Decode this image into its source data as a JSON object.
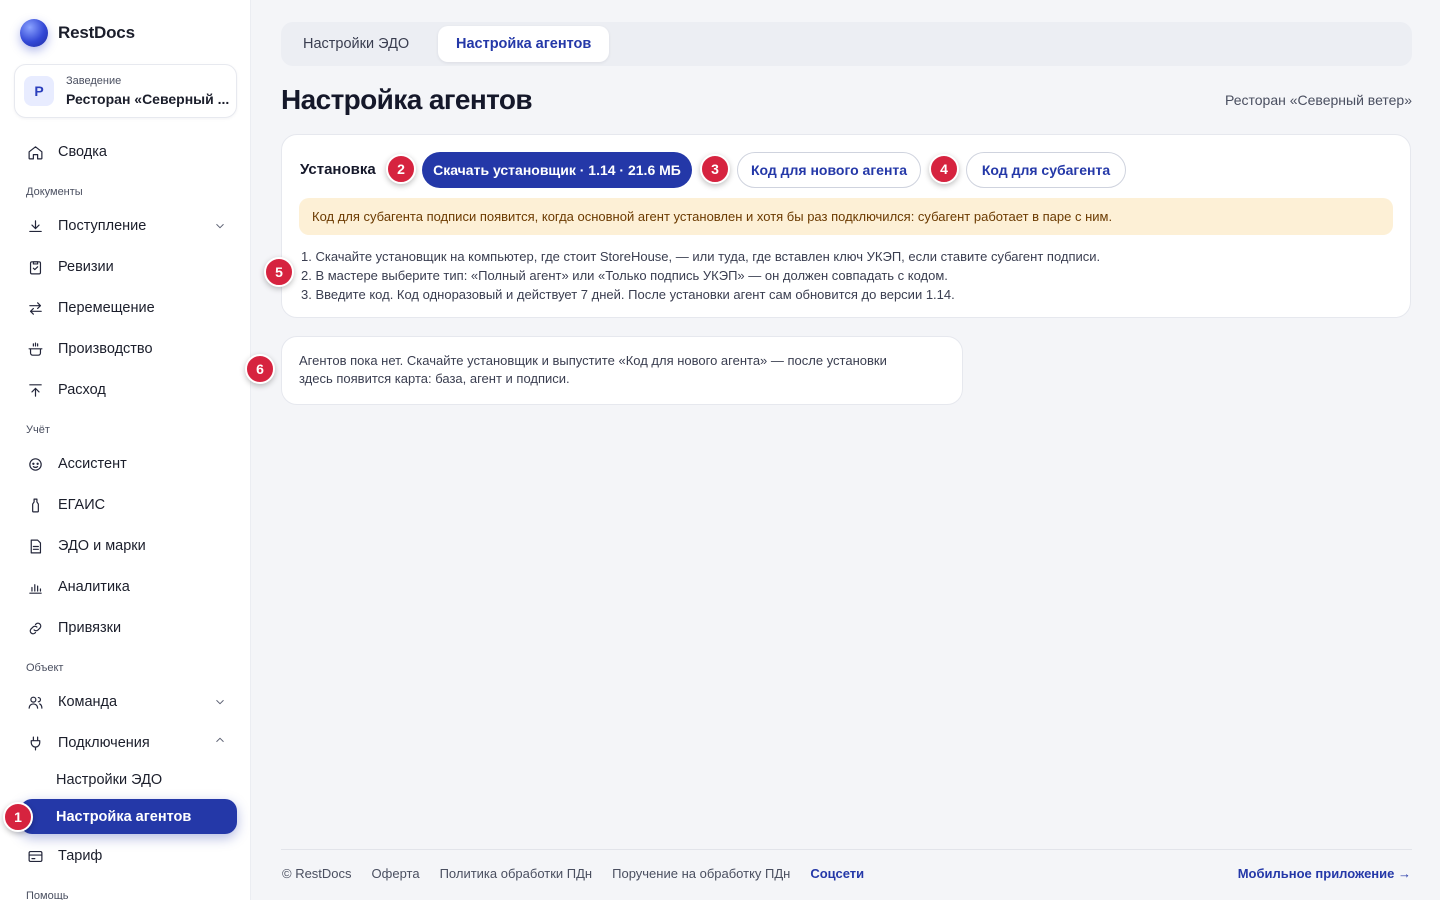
{
  "brand": {
    "name": "RestDocs"
  },
  "venue": {
    "avatar": "Р",
    "label": "Заведение",
    "name": "Ресторан «Северный ..."
  },
  "sidebar": {
    "items": [
      {
        "label": "Сводка",
        "icon": "home-icon"
      },
      {
        "label": "Поступление",
        "icon": "download-icon"
      },
      {
        "label": "Ревизии",
        "icon": "clipboard-check-icon"
      },
      {
        "label": "Перемещение",
        "icon": "arrows-swap-icon"
      },
      {
        "label": "Производство",
        "icon": "pot-icon"
      },
      {
        "label": "Расход",
        "icon": "upload-icon"
      },
      {
        "label": "Ассистент",
        "icon": "assistant-icon"
      },
      {
        "label": "ЕГАИС",
        "icon": "bottle-icon"
      },
      {
        "label": "ЭДО и марки",
        "icon": "document-icon"
      },
      {
        "label": "Аналитика",
        "icon": "bar-chart-icon"
      },
      {
        "label": "Привязки",
        "icon": "link-icon"
      },
      {
        "label": "Команда",
        "icon": "users-icon"
      },
      {
        "label": "Подключения",
        "icon": "plug-icon"
      },
      {
        "label": "Тариф",
        "icon": "card-icon"
      }
    ],
    "sections": [
      "Документы",
      "Учёт",
      "Объект",
      "Помощь"
    ],
    "sub_items": [
      "Настройки ЭДО",
      "Настройка агентов"
    ]
  },
  "badges": [
    "1",
    "2",
    "3",
    "4",
    "5",
    "6"
  ],
  "tabs": [
    "Настройки ЭДО",
    "Настройка агентов"
  ],
  "page": {
    "title": "Настройка агентов",
    "restaurant": "Ресторан «Северный ветер»"
  },
  "install": {
    "label": "Установка",
    "download_button": "Скачать установщик · 1.14 · 21.6 МБ",
    "new_agent_button": "Код для нового агента",
    "subagent_button": "Код для субагента",
    "warning": "Код для субагента подписи появится, когда основной агент установлен и хотя бы раз подключился: субагент работает в паре с ним.",
    "steps": [
      "1. Скачайте установщик на компьютер, где стоит StoreHouse, — или туда, где вставлен ключ УКЭП, если ставите субагент подписи.",
      "2. В мастере выберите тип: «Полный агент» или «Только подпись УКЭП» — он должен совпадать с кодом.",
      "3. Введите код. Код одноразовый и действует 7 дней. После установки агент сам обновится до версии 1.14."
    ]
  },
  "empty_state": {
    "line1": "Агентов пока нет. Скачайте установщик и выпустите «Код для нового агента» — после установки",
    "line2": "здесь появится карта: база, агент и подписи."
  },
  "footer": {
    "copyright": "© RestDocs",
    "offer": "Оферта",
    "policy": "Политика обработки ПДн",
    "instruction": "Поручение на обработку ПДн",
    "social": "Соцсети",
    "mobile": "Мобильное приложение →"
  },
  "colors": {
    "accent": "#2438a8",
    "badge": "#d6233f",
    "warning_bg": "#fdf0d6"
  }
}
